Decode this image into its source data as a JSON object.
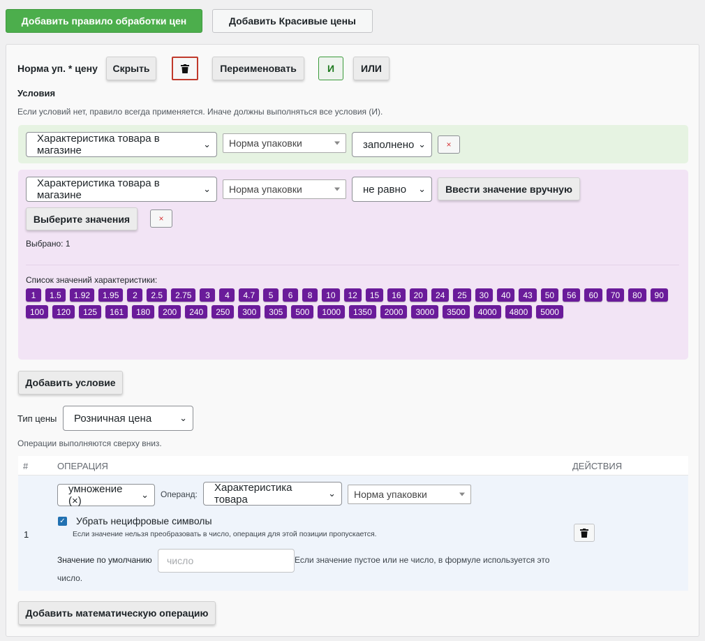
{
  "toolbar": {
    "add_rule_label": "Добавить правило обработки цен",
    "add_pretty_label": "Добавить Красивые цены"
  },
  "rule": {
    "title": "Норма уп. * цену",
    "hide_label": "Скрыть",
    "rename_label": "Переименовать",
    "and_label": "И",
    "or_label": "ИЛИ",
    "conditions_heading": "Условия",
    "conditions_hint": "Если условий нет, правило всегда применяется. Иначе должны выполняться все условия (И).",
    "condition1": {
      "source": "Характеристика товара в магазине",
      "attribute": "Норма упаковки",
      "operator": "заполнено",
      "remove_label": "×"
    },
    "condition2": {
      "source": "Характеристика товара в магазине",
      "attribute": "Норма упаковки",
      "operator": "не равно",
      "manual_label": "Ввести значение вручную",
      "choose_label": "Выберите значения",
      "remove_label": "×",
      "selected_text": "Выбрано: 1",
      "values_caption": "Список значений характеристики:",
      "values": [
        "1",
        "1.5",
        "1.92",
        "1.95",
        "2",
        "2.5",
        "2.75",
        "3",
        "4",
        "4.7",
        "5",
        "6",
        "8",
        "10",
        "12",
        "15",
        "16",
        "20",
        "24",
        "25",
        "30",
        "40",
        "43",
        "50",
        "56",
        "60",
        "70",
        "80",
        "90",
        "100",
        "120",
        "125",
        "161",
        "180",
        "200",
        "240",
        "250",
        "300",
        "305",
        "500",
        "1000",
        "1350",
        "2000",
        "3000",
        "3500",
        "4000",
        "4800",
        "5000"
      ]
    },
    "add_condition_label": "Добавить условие",
    "price_type_label": "Тип цены",
    "price_type_value": "Розничная цена",
    "ops_hint": "Операции выполняются сверху вниз.",
    "table": {
      "col_num": "#",
      "col_op": "ОПЕРАЦИЯ",
      "col_actions": "ДЕЙСТВИЯ"
    },
    "operation": {
      "num": "1",
      "op": "умножение (×)",
      "operand_label": "Операнд:",
      "operand_source": "Характеристика товара",
      "operand_attr": "Норма упаковки",
      "strip_label": "Убрать нецифровые символы",
      "strip_checked": true,
      "strip_hint": "Если значение нельзя преобразовать в число, операция для этой позиции пропускается.",
      "default_label": "Значение по умолчанию",
      "default_placeholder": "число",
      "default_hint_a": "Если значение пустое или не число, в формуле используется это",
      "default_hint_b": "число."
    },
    "add_math_label": "Добавить математическую операцию"
  }
}
